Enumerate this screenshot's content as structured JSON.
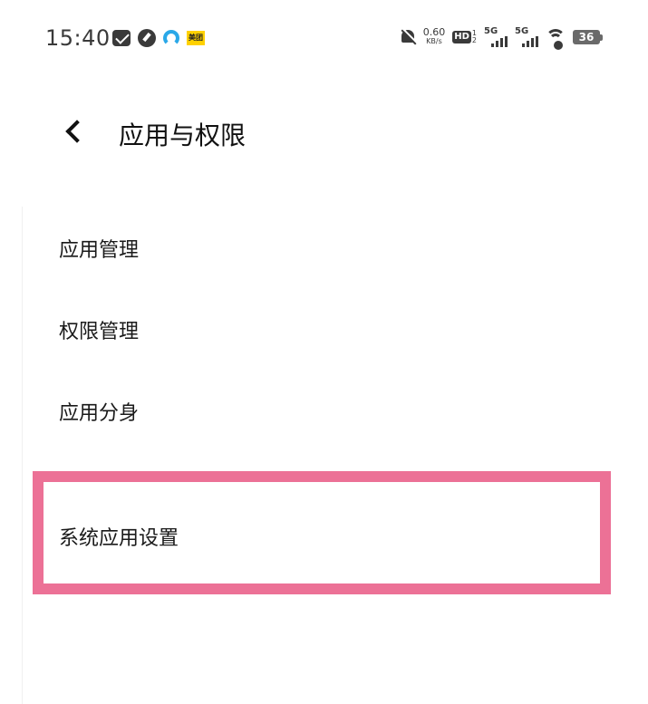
{
  "status_bar": {
    "time": "15:40",
    "notification_icons": [
      "mail-icon",
      "compass-icon",
      "browser-icon",
      "meituan-icon"
    ],
    "meituan_label": "美团",
    "net_speed_value": "0.60",
    "net_speed_unit": "KB/s",
    "hd_label": "HD",
    "hd_sim_top": "1",
    "hd_sim_bottom": "2",
    "signal_1_label": "5G",
    "signal_2_label": "5G",
    "battery_level": "36"
  },
  "header": {
    "title": "应用与权限",
    "back_icon": "chevron-left-icon"
  },
  "menu": {
    "items": [
      {
        "label": "应用管理"
      },
      {
        "label": "权限管理"
      },
      {
        "label": "应用分身"
      },
      {
        "label": "系统应用设置",
        "highlighted": true
      }
    ]
  },
  "colors": {
    "highlight_border": "#ec7196",
    "text": "#1a1a1a",
    "background": "#ffffff"
  }
}
